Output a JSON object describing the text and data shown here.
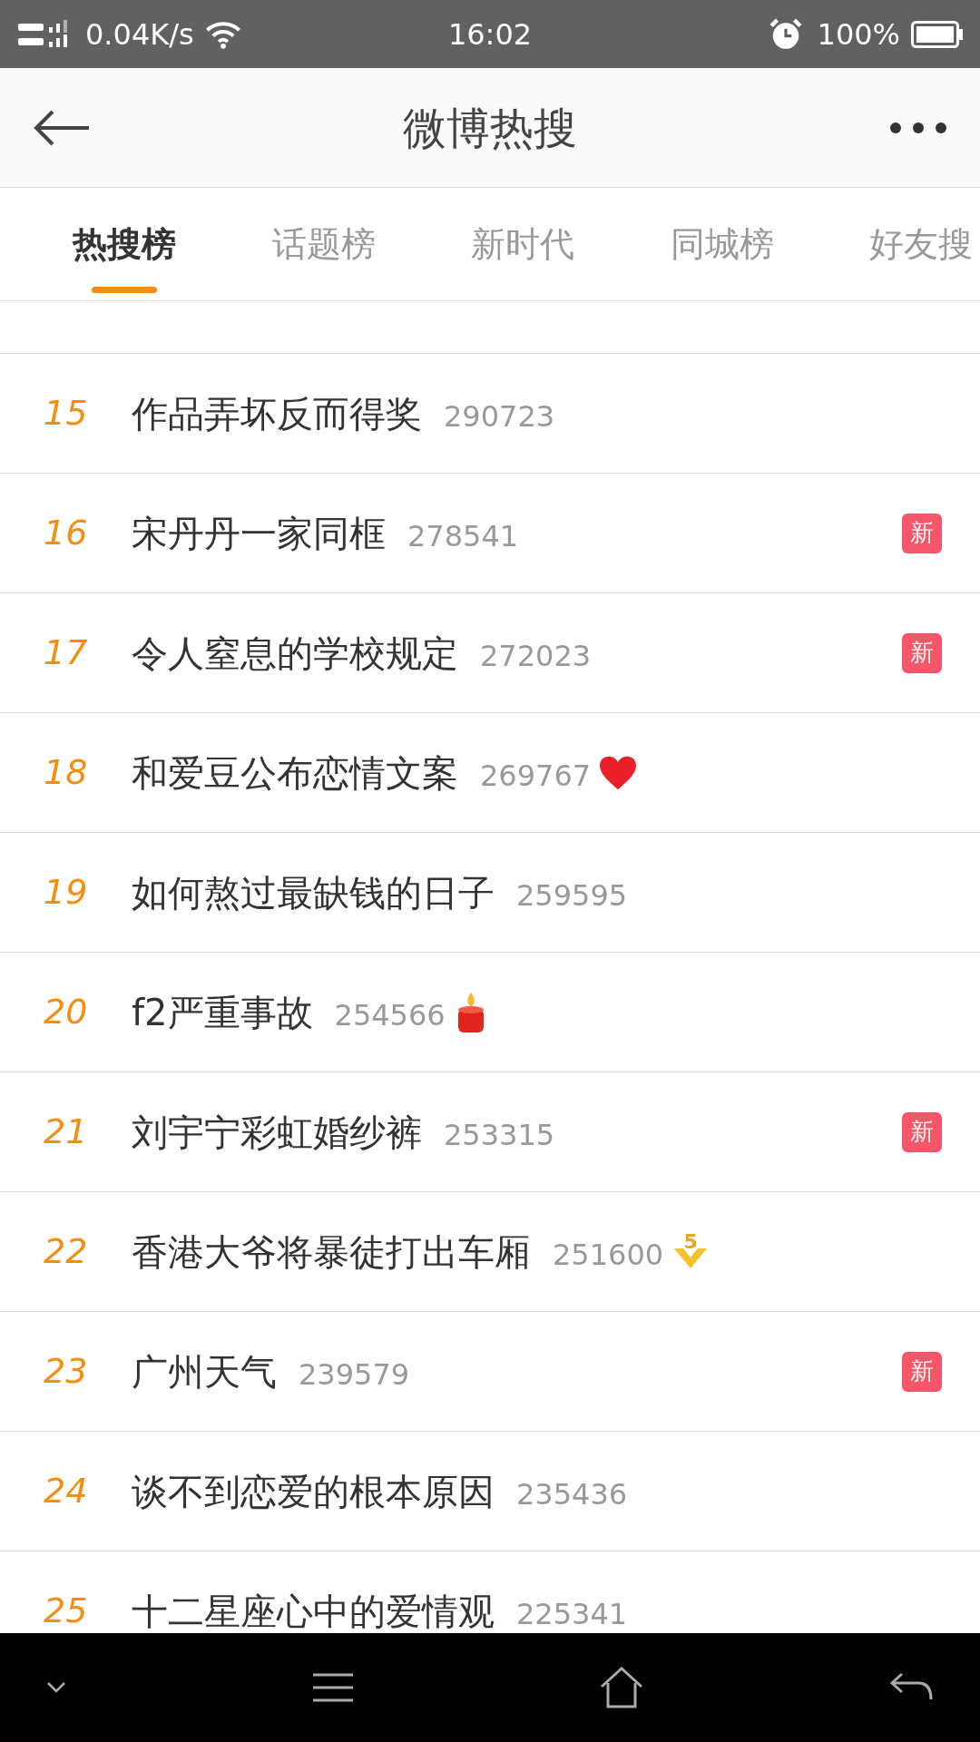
{
  "status_bar": {
    "network": "0.04K/s",
    "time": "16:02",
    "battery": "100%"
  },
  "header": {
    "title": "微博热搜"
  },
  "tabs": [
    {
      "label": "热搜榜",
      "selected": true
    },
    {
      "label": "话题榜",
      "selected": false
    },
    {
      "label": "新时代",
      "selected": false
    },
    {
      "label": "同城榜",
      "selected": false
    },
    {
      "label": "好友搜",
      "selected": false
    }
  ],
  "rows": [
    {
      "rank": "15",
      "title": "作品弄坏反而得奖",
      "count": "290723"
    },
    {
      "rank": "16",
      "title": "宋丹丹一家同框",
      "count": "278541",
      "badge": {
        "kind": "new",
        "text": "新"
      }
    },
    {
      "rank": "17",
      "title": "令人窒息的学校规定",
      "count": "272023",
      "badge": {
        "kind": "new",
        "text": "新"
      }
    },
    {
      "rank": "18",
      "title": "和爱豆公布恋情文案",
      "count": "269767",
      "badge": {
        "kind": "heart"
      }
    },
    {
      "rank": "19",
      "title": "如何熬过最缺钱的日子",
      "count": "259595"
    },
    {
      "rank": "20",
      "title": "f2严重事故",
      "count": "254566",
      "badge": {
        "kind": "candle"
      }
    },
    {
      "rank": "21",
      "title": "刘宇宁彩虹婚纱裤",
      "count": "253315",
      "badge": {
        "kind": "new",
        "text": "新"
      }
    },
    {
      "rank": "22",
      "title": "香港大爷将暴徒打出车厢",
      "count": "251600",
      "badge": {
        "kind": "rank_drop",
        "text": "5"
      }
    },
    {
      "rank": "23",
      "title": "广州天气",
      "count": "239579",
      "badge": {
        "kind": "new",
        "text": "新"
      }
    },
    {
      "rank": "24",
      "title": "谈不到恋爱的根本原因",
      "count": "235436"
    },
    {
      "rank": "25",
      "title": "十二星座心中的爱情观",
      "count": "225341"
    }
  ]
}
